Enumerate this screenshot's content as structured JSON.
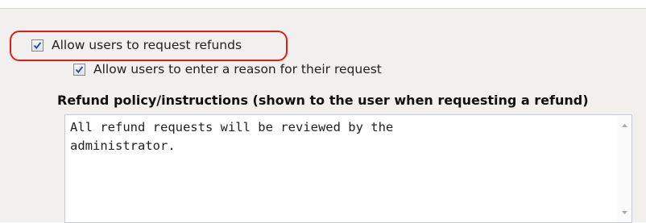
{
  "refunds": {
    "allow_requests": {
      "label": "Allow users to request refunds",
      "checked": true
    },
    "allow_reason": {
      "label": "Allow users to enter a reason for their request",
      "checked": true
    },
    "policy": {
      "label": "Refund policy/instructions (shown to the user when requesting a refund)",
      "value": "All refund requests will be reviewed by the\nadministrator."
    }
  },
  "icons": {
    "checkmark": "checkmark-icon",
    "scroll_up": "scroll-up-arrow-icon",
    "scroll_down": "scroll-down-arrow-icon"
  },
  "colors": {
    "highlight_outline": "#e01b1b",
    "checkmark": "#2c4a9e",
    "panel_background": "#f1f0ee"
  }
}
